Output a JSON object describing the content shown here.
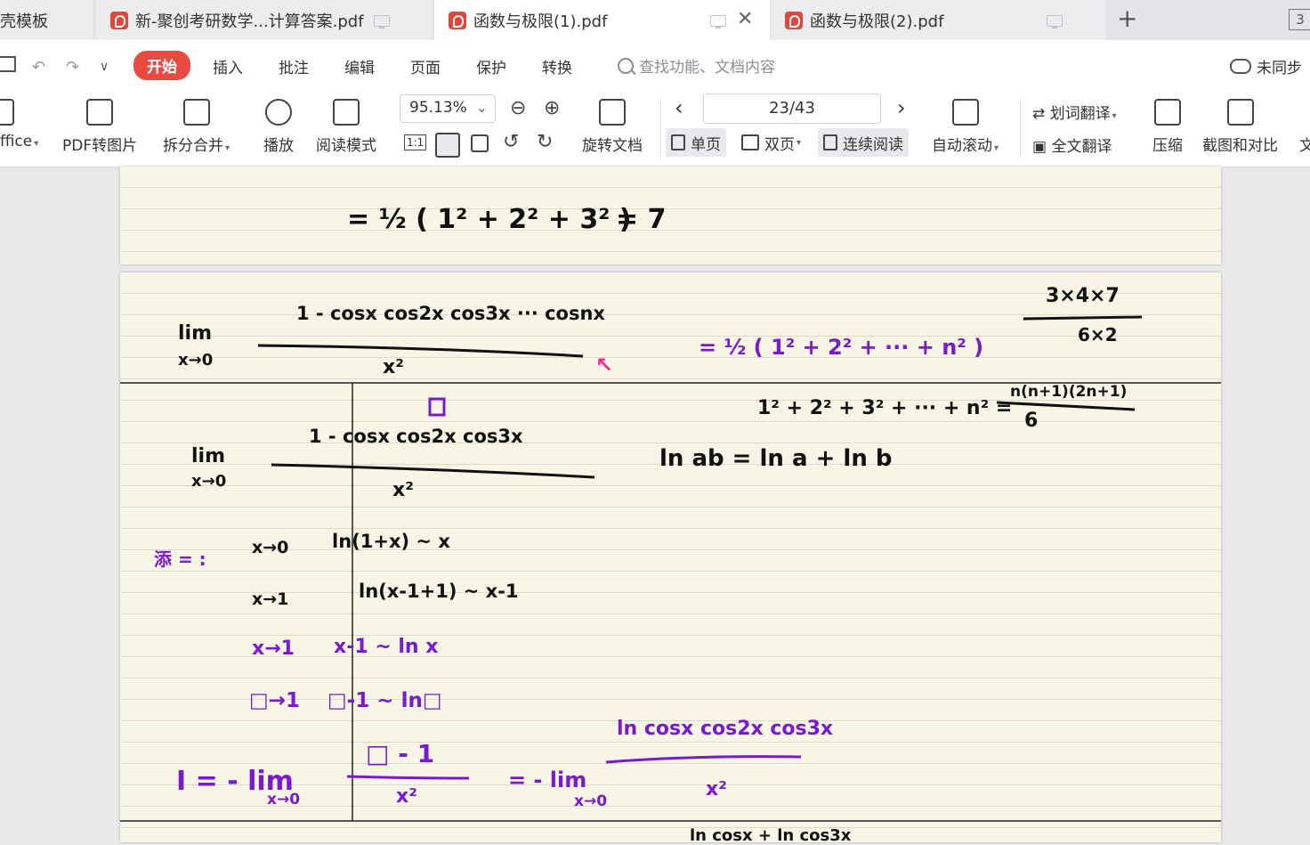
{
  "tabs": [
    {
      "label": "壳模板"
    },
    {
      "label": "新-聚创考研数学...计算答案.pdf"
    },
    {
      "label": "函数与极限(1).pdf"
    },
    {
      "label": "函数与极限(2).pdf"
    }
  ],
  "tab_new": "+",
  "tab_close": "✕",
  "tab_corner": "3",
  "menu": {
    "items": [
      "开始",
      "插入",
      "批注",
      "编辑",
      "页面",
      "保护",
      "转换"
    ],
    "search_placeholder": "查找功能、文档内容",
    "sync": "未同步"
  },
  "toolbar": {
    "office": "ffice",
    "pdf_to_image": "PDF转图片",
    "split_merge": "拆分合并",
    "play": "播放",
    "read_mode": "阅读模式",
    "zoom": "95.13%",
    "actual_size": "1:1",
    "rotate": "旋转文档",
    "page_indicator": "23/43",
    "single": "单页",
    "double": "双页",
    "continuous": "连续阅读",
    "auto_scroll": "自动滚动",
    "word_translate": "划词翻译",
    "full_translate": "全文翻译",
    "compress": "压缩",
    "screenshot_compare": "截图和对比",
    "more": "文"
  },
  "notes": {
    "p1_line": "= ½ ( 1² + 2² + 3² )",
    "p1_result": "= 7",
    "lim": "lim",
    "x_to_0": "x→0",
    "numerator1": "1 - cosx cos2x cos3x ··· cosnx",
    "denominator": "x²",
    "pink_mark": "↖",
    "sum_half": "= ½ ( 1² + 2² + ··· + n² )",
    "frac_top": "3×4×7",
    "frac_bottom": "6×2",
    "box_mark": "□",
    "sum_formula": "1² + 2² + 3² + ··· + n² =",
    "sum_top": "n(n+1)(2n+1)",
    "sum_bottom": "6",
    "numerator2": "1 - cosx cos2x cos3x",
    "log_rule": "ln ab = ln a + ln b",
    "note_label": "添 = :",
    "r1a": "x→0",
    "r1b": "ln(1+x) ~ x",
    "r2a": "x→1",
    "r2b": "ln(x-1+1) ~ x-1",
    "r3a": "x→1",
    "r3b": "x-1 ~ ln x",
    "r4a": "□→1",
    "r4b": "□-1 ~ ln□",
    "I_eq": "I = - lim",
    "I_sub": "x→0",
    "I_num": "□ - 1",
    "I_den": "x²",
    "I_eq2": "= - lim",
    "I_num2": "ln cosx cos2x cos3x",
    "I_den2": "x²",
    "bottom_peek": "ln cosx + ln cos3x"
  },
  "colors": {
    "accent": "#e94b43",
    "ink_purple": "#7a1ad0",
    "ink_pink": "#ef2f92",
    "paper": "#f7f5e5"
  }
}
